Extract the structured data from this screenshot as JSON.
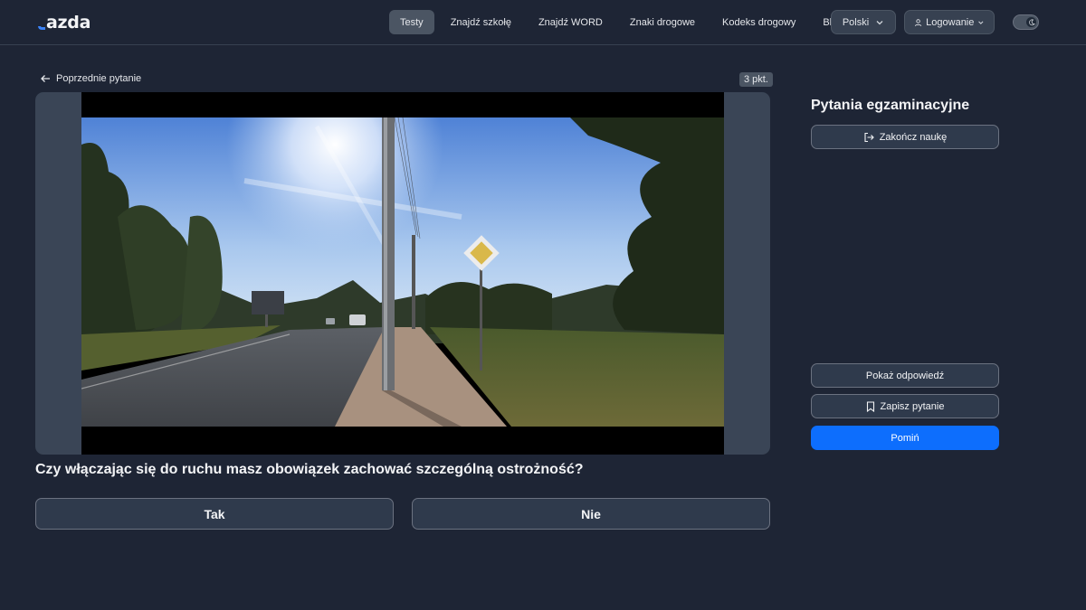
{
  "header": {
    "logo_text": "azda",
    "nav": [
      "Testy",
      "Znajdź szkołę",
      "Znajdź WORD",
      "Znaki drogowe",
      "Kodeks drogowy",
      "Blog"
    ],
    "active_nav": "Testy",
    "language": "Polski",
    "login": "Logowanie"
  },
  "question_panel": {
    "previous_label": "Poprzednie pytanie",
    "points": "3 pkt.",
    "question": "Czy włączając się do ruchu masz obowiązek zachować szczególną ostrożność?",
    "answers": [
      "Tak",
      "Nie"
    ]
  },
  "sidebar": {
    "title": "Pytania egzaminacyjne",
    "end_label": "Zakończ naukę",
    "show_answer": "Pokaż odpowiedź",
    "save_question": "Zapisz pytanie",
    "skip": "Pomiń"
  },
  "colors": {
    "background": "#1e2535",
    "primary": "#0d6efd",
    "card": "#2f3a4c"
  }
}
